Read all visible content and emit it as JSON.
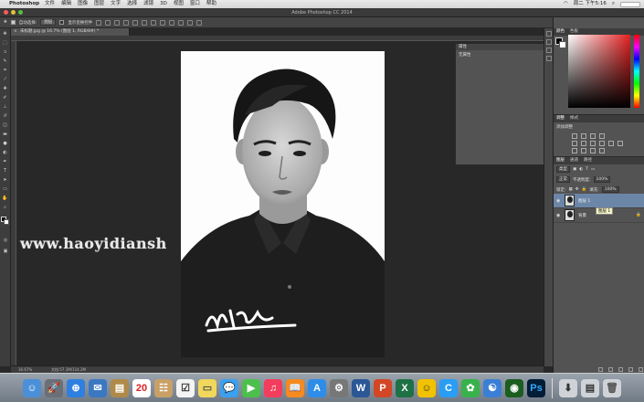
{
  "menubar": {
    "app_name": "Photoshop",
    "menus": [
      "文件",
      "编辑",
      "图像",
      "图层",
      "文字",
      "选择",
      "滤镜",
      "3D",
      "视图",
      "窗口",
      "帮助"
    ],
    "clock": "周二 下午5:16"
  },
  "window": {
    "title": "Adobe Photoshop CC 2014"
  },
  "options_bar": {
    "auto_select_label": "自动选择:",
    "auto_select_value": "图层",
    "show_transform_label": "显示变换控件",
    "workspace": "基本功能"
  },
  "document": {
    "tab_label": "未标题.jpg @ 16.7% (图层 1, RGB/8#) *",
    "zoom": "16.67%",
    "doc_size": "文档:57.1M/114.2M",
    "watermark": "www.haoyidiansh"
  },
  "panels": {
    "properties": {
      "title": "属性",
      "subtitle": "无属性"
    },
    "color": {
      "tabs": [
        "颜色",
        "色板"
      ]
    },
    "adjustments": {
      "tabs": [
        "调整",
        "样式"
      ],
      "label": "添加调整"
    },
    "layers": {
      "tabs": [
        "图层",
        "通道",
        "路径"
      ],
      "kind": "类型",
      "mode": "正常",
      "opacity_label": "不透明度:",
      "opacity_value": "100%",
      "lock_label": "锁定:",
      "fill_label": "填充:",
      "fill_value": "100%",
      "items": [
        {
          "name": "图层 1",
          "selected": true
        },
        {
          "name": "背景",
          "selected": false
        }
      ],
      "tooltip": "图层 1"
    }
  },
  "dock_icons": [
    "finder",
    "launchpad",
    "safari",
    "mail",
    "notes",
    "calendar",
    "contacts",
    "reminders",
    "notes2",
    "messages",
    "facetime",
    "music",
    "books",
    "appstore",
    "settings",
    "word",
    "powerpoint",
    "excel",
    "qq",
    "wechat",
    "baidu",
    "chrome",
    "photoshop"
  ],
  "calendar_day": "20"
}
